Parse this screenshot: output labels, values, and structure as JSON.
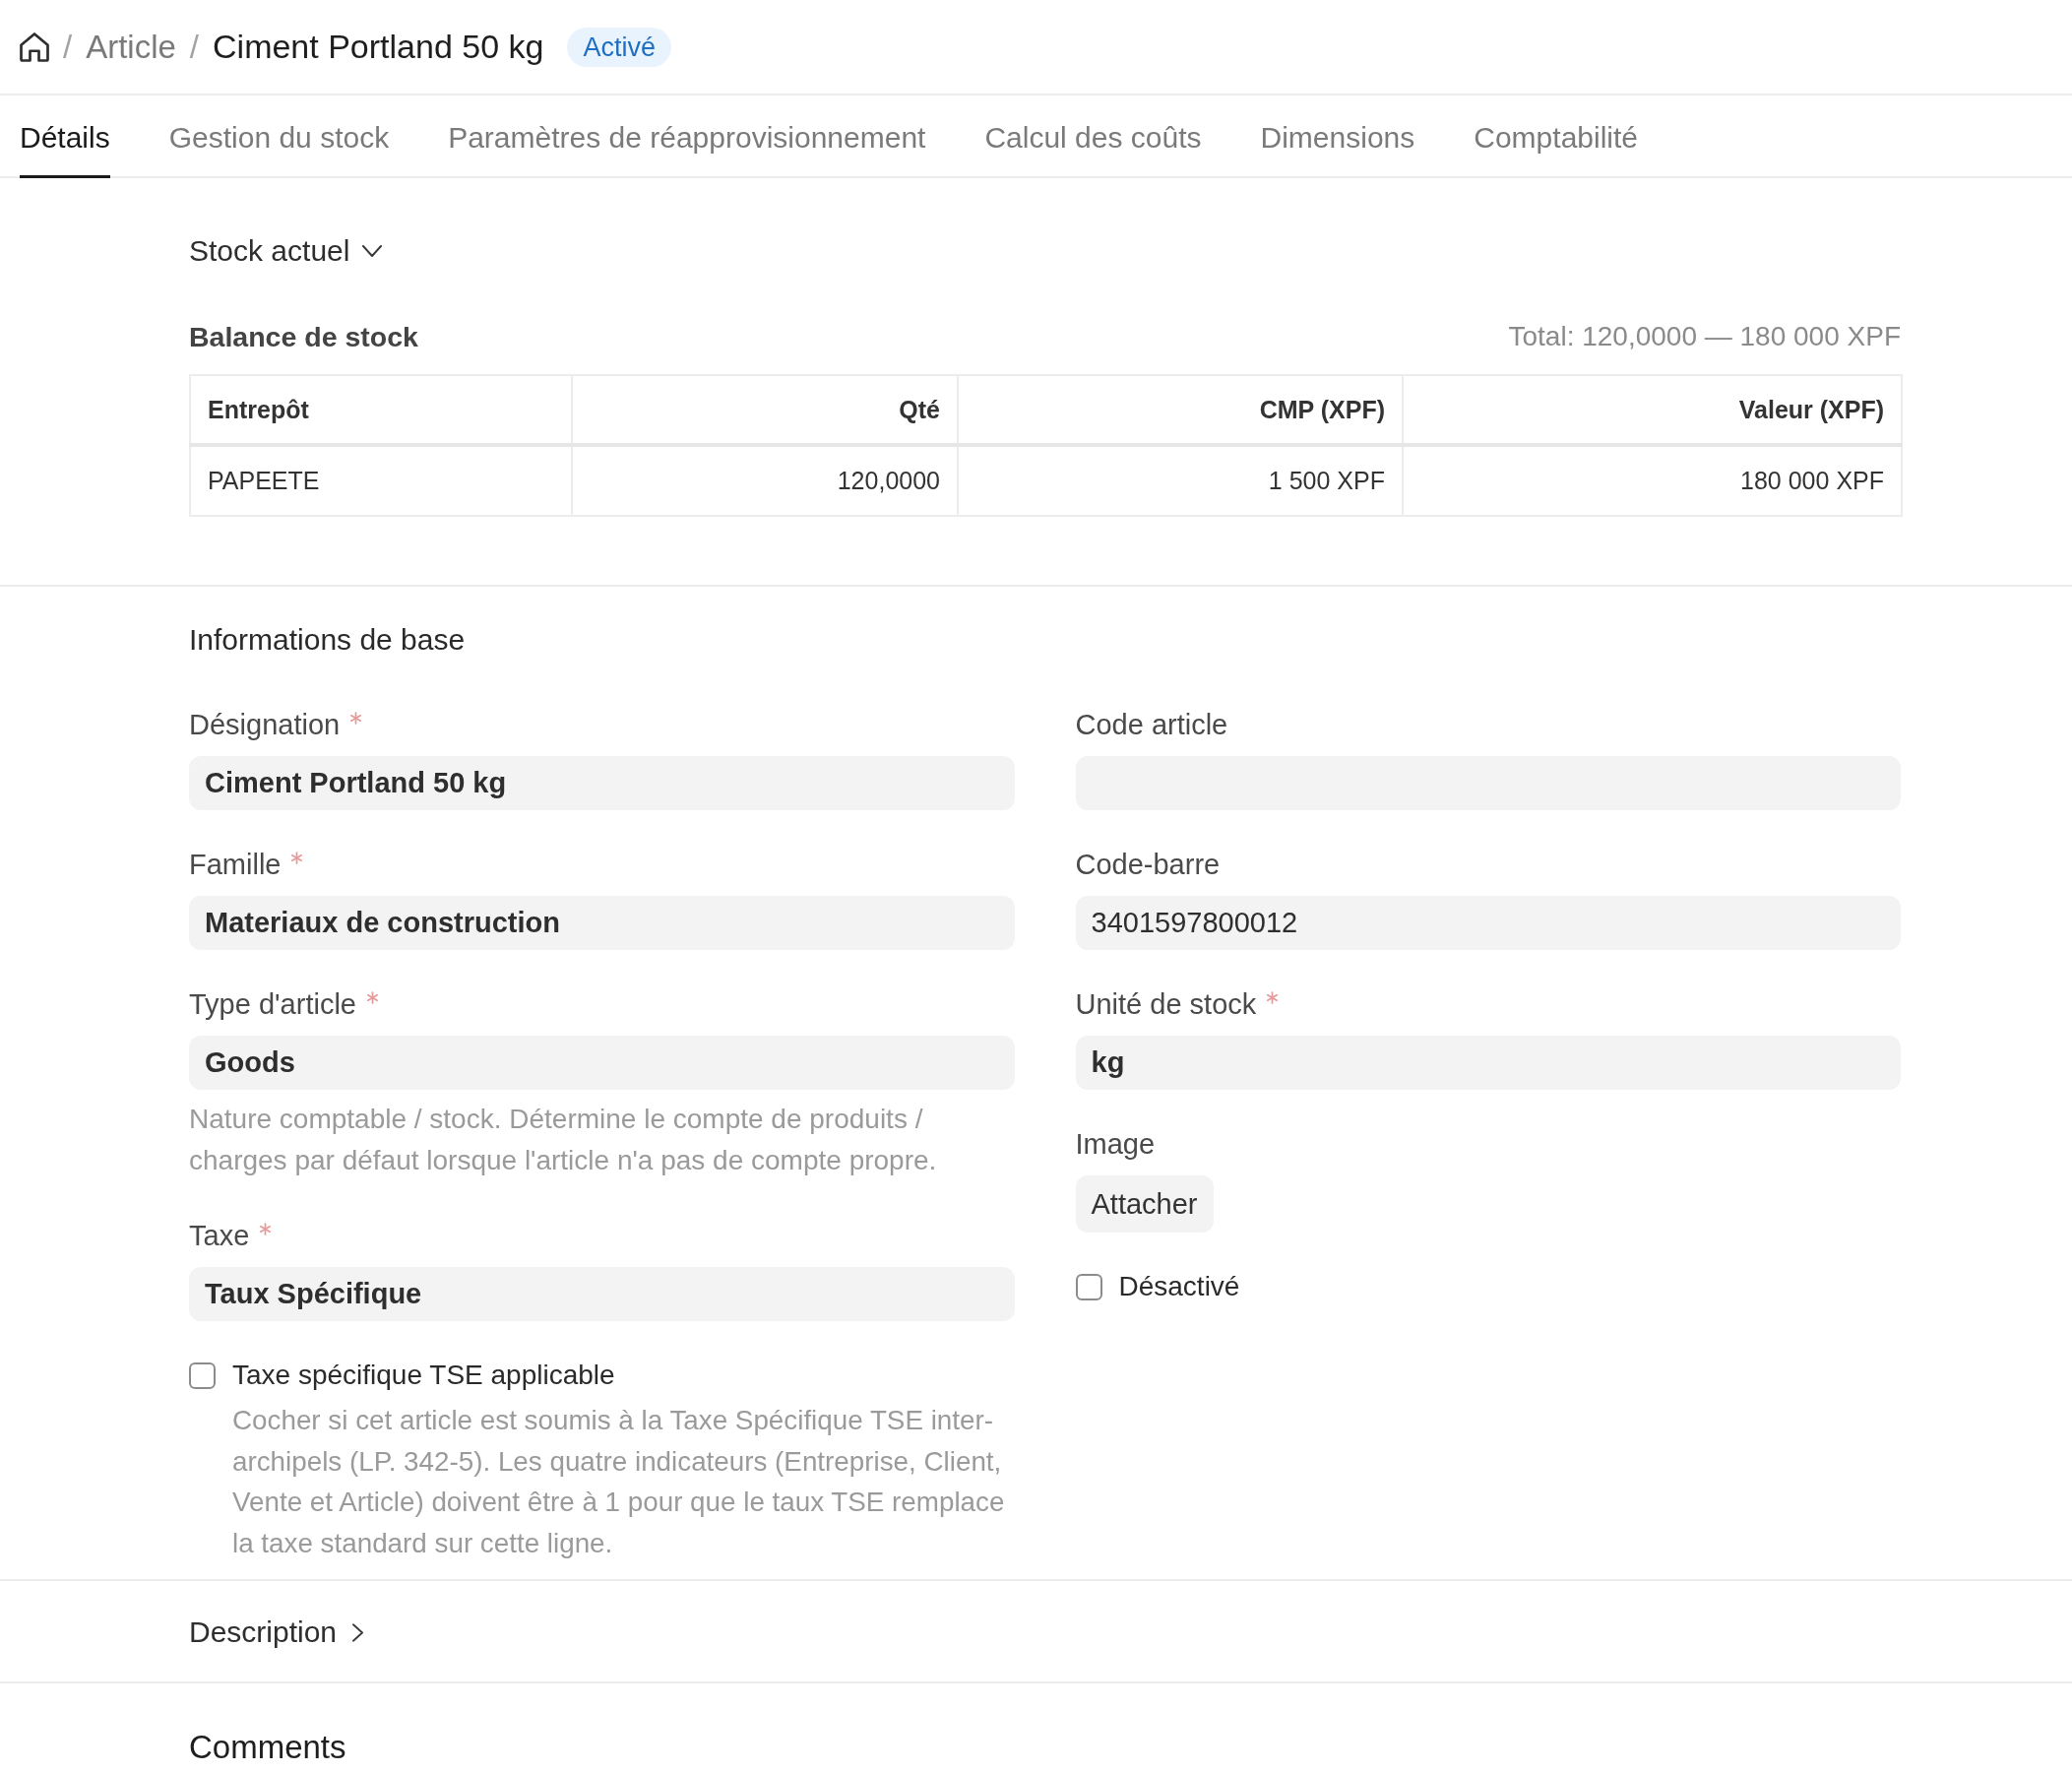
{
  "header": {
    "breadcrumb": [
      {
        "kind": "home"
      },
      {
        "kind": "separator",
        "text": "/"
      },
      {
        "kind": "link",
        "text": "Article"
      },
      {
        "kind": "separator",
        "text": "/"
      },
      {
        "kind": "current",
        "text": "Ciment Portland 50 kg"
      }
    ],
    "status_badge": "Activé"
  },
  "tabs": [
    {
      "label": "Détails",
      "selected": true
    },
    {
      "label": "Gestion du stock",
      "selected": false
    },
    {
      "label": "Paramètres de réapprovisionnement",
      "selected": false
    },
    {
      "label": "Calcul des coûts",
      "selected": false
    },
    {
      "label": "Dimensions",
      "selected": false
    },
    {
      "label": "Comptabilité",
      "selected": false
    }
  ],
  "stock_section": {
    "title": "Stock actuel",
    "expanded": true,
    "table_title": "Balance de stock",
    "total": "Total: 120,0000 — 180 000 XPF",
    "table": {
      "columns": [
        "Entrepôt",
        "Qté",
        "CMP (XPF)",
        "Valeur (XPF)"
      ],
      "rows": [
        [
          "PAPEETE",
          "120,0000",
          "1 500 XPF",
          "180 000 XPF"
        ]
      ]
    }
  },
  "basic_info": {
    "title": "Informations de base",
    "left_fields": [
      {
        "kind": "link",
        "label": "Désignation",
        "required": true,
        "value": "Ciment Portland 50 kg"
      },
      {
        "kind": "link",
        "label": "Famille",
        "required": true,
        "value": "Materiaux de construction"
      },
      {
        "kind": "link",
        "label": "Type d'article",
        "required": true,
        "value": "Goods",
        "help": "Nature comptable / stock. Détermine le compte de produits / charges par défaut lorsque l'article n'a pas de compte propre."
      },
      {
        "kind": "link",
        "label": "Taxe",
        "required": true,
        "value": "Taux Spécifique"
      },
      {
        "kind": "checkbox",
        "label": "Taxe spécifique TSE applicable",
        "checked": false,
        "help": "Cocher si cet article est soumis à la Taxe Spécifique TSE inter-archipels (LP. 342-5). Les quatre indicateurs (Entreprise, Client, Vente et Article) doivent être à 1 pour que le taux TSE remplace la taxe standard sur cette ligne."
      }
    ],
    "right_fields": [
      {
        "kind": "data",
        "label": "Code article",
        "required": false
      },
      {
        "kind": "data",
        "label": "Code-barre",
        "required": false,
        "value": "3401597800012"
      },
      {
        "kind": "link",
        "label": "Unité de stock",
        "required": true,
        "value": "kg"
      },
      {
        "kind": "attach",
        "label": "Image",
        "required": false,
        "button_label": "Attacher"
      },
      {
        "kind": "checkbox",
        "label": "Désactivé",
        "checked": false
      }
    ]
  },
  "description_section": {
    "title": "Description",
    "expanded": false
  },
  "comments_section": {
    "title": "Comments"
  }
}
